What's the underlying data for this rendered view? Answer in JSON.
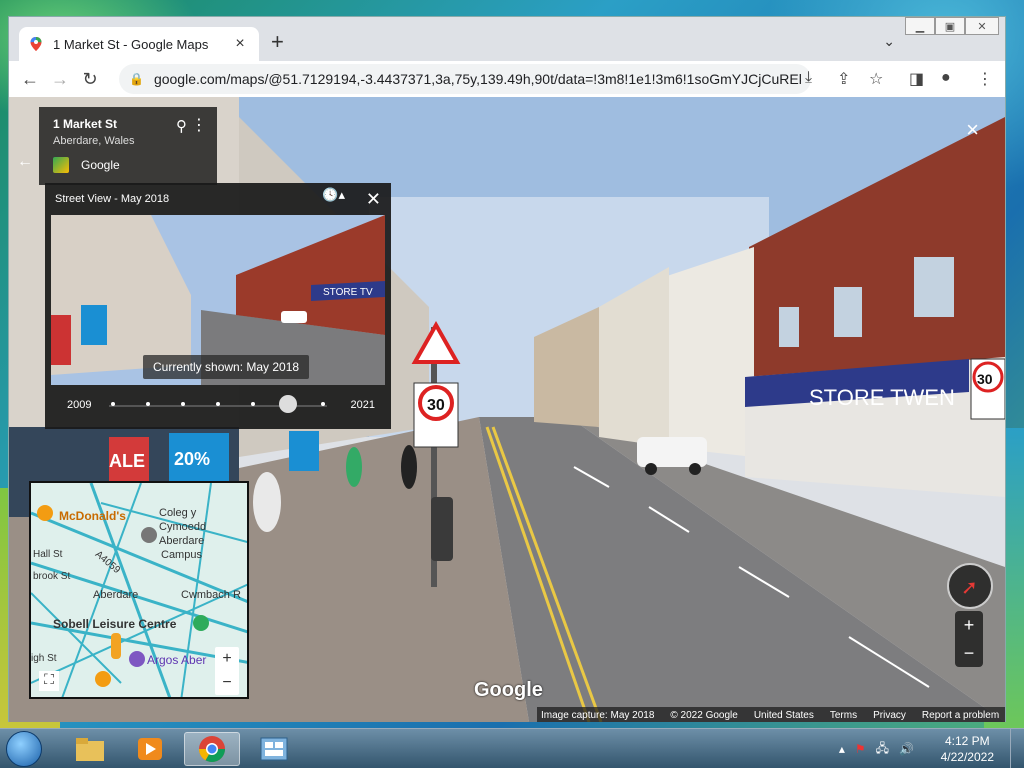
{
  "browser": {
    "tab_title": "1 Market St - Google Maps",
    "tab_close": "×",
    "new_tab": "+",
    "tab_menu": "⌄",
    "url": "google.com/maps/@51.7129194,-3.4437371,3a,75y,139.49h,90t/data=!3m8!1e1!3m6!1soGmYJCjCuREk...",
    "controls": {
      "back": "←",
      "forward": "→",
      "reload": "↻"
    }
  },
  "infocard": {
    "street": "1 Market St",
    "city": "Aberdare, Wales",
    "provider": "Google"
  },
  "timemachine": {
    "title": "Street View - May 2018",
    "current_label": "Currently shown: May 2018",
    "start_year": "2009",
    "end_year": "2021",
    "dots": 7,
    "selected_index": 5
  },
  "minimap": {
    "labels": {
      "mcdonalds": "McDonald's",
      "college1": "Coleg y",
      "college2": "Cymoedd",
      "college3": "Aberdare",
      "college4": "Campus",
      "hall_st": "Hall St",
      "brook_st": "brook St",
      "a4059": "A4059",
      "cwmbach": "Cwmbach R",
      "aberdare": "Aberdare",
      "sobell": "Sobell Leisure Centre",
      "argos": "Argos Aber",
      "high_st": "igh St"
    },
    "zoom_in": "+",
    "zoom_out": "−"
  },
  "viewer": {
    "close": "×",
    "zoom_in": "+",
    "zoom_out": "−",
    "google_logo": "Google",
    "scene": {
      "store_sign": "STORE TWEN",
      "thumb_store_sign": "STORE TV",
      "speed_limit": "30",
      "shop_sign_small": "ALE",
      "shop_sign_pct": "20%"
    }
  },
  "footer": {
    "capture": "Image capture: May 2018",
    "copyright": "© 2022 Google",
    "region": "United States",
    "terms": "Terms",
    "privacy": "Privacy",
    "report": "Report a problem"
  },
  "taskbar": {
    "time": "4:12 PM",
    "date": "4/22/2022"
  }
}
